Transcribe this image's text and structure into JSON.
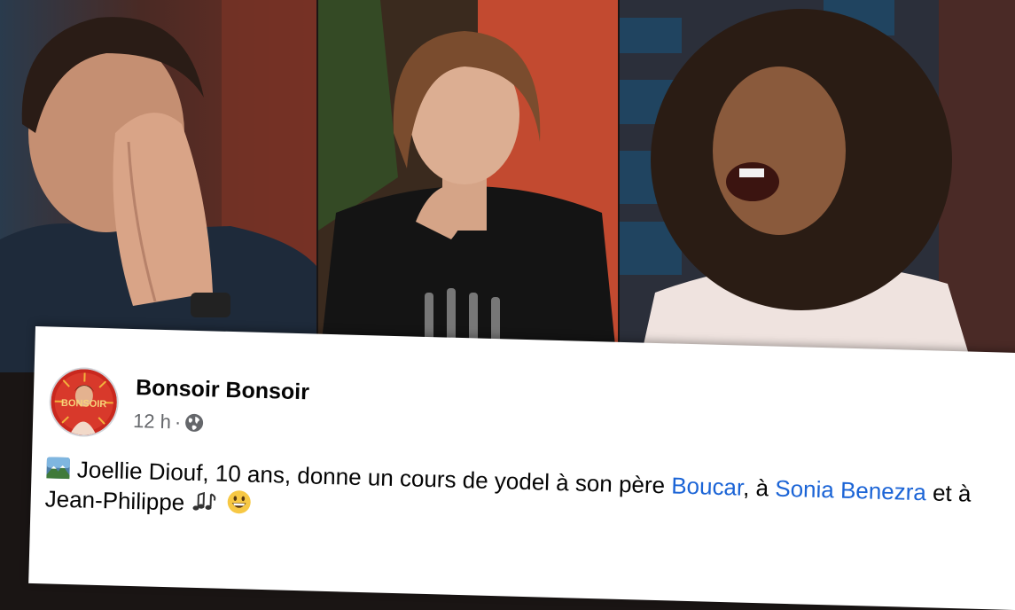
{
  "post": {
    "author": "Bonsoir Bonsoir",
    "avatar_text": "BONSOIR",
    "time": "12 h",
    "separator": "·",
    "privacy_icon": "globe-icon",
    "body": {
      "lead_icon": "landscape-photo-icon",
      "text_1": " Joellie Diouf, 10 ans, donne un cours de yodel à son père ",
      "mention_1": "Boucar",
      "text_2": ", à ",
      "mention_2": "Sonia Benezra",
      "text_3": " et à Jean-Philippe ",
      "emoji_music": "musical-notes-emoji",
      "emoji_smile": "grinning-face-emoji"
    }
  },
  "colors": {
    "link": "#1b64d6",
    "author_text": "#050505",
    "meta_text": "#65676b",
    "card_background": "#ffffff"
  }
}
